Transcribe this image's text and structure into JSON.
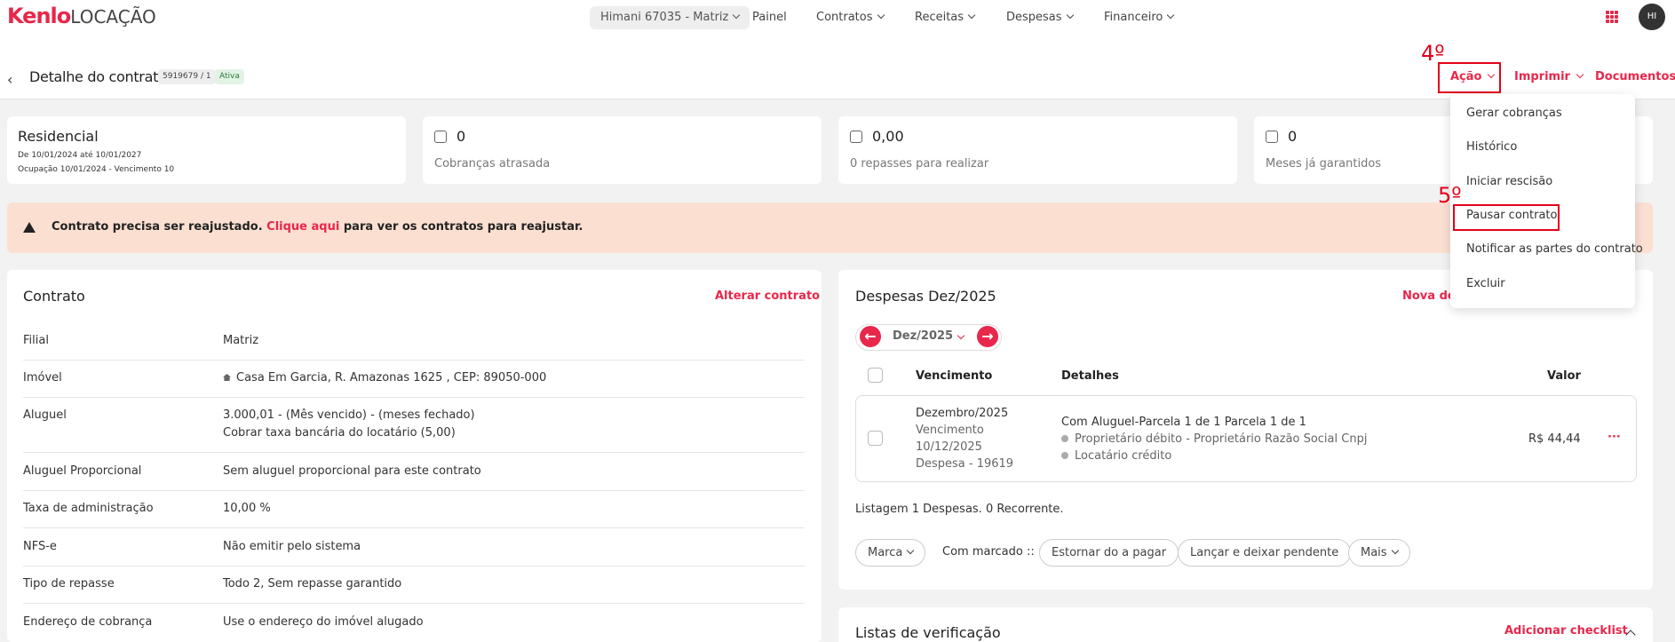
{
  "brand": {
    "kenlo": "Kenlo",
    "locacao": "LOCAÇÃO"
  },
  "nav": {
    "branch": "Himani 67035 - Matriz",
    "items": [
      "Painel",
      "Contratos",
      "Receitas",
      "Despesas",
      "Financeiro"
    ],
    "avatar": "HI"
  },
  "header": {
    "title": "Detalhe do contrato",
    "contract_number": "5919679 / 1",
    "status": "Ativa",
    "acao": "Ação",
    "imprimir": "Imprimir",
    "documentos": "Documentos"
  },
  "annotations": {
    "step4": "4º",
    "step5": "5º"
  },
  "summary": {
    "type": "Residencial",
    "period": "De 10/01/2024 até 10/01/2027",
    "occupancy": "Ocupação 10/01/2024 - Vencimento 10",
    "overdue_value": "0",
    "overdue_label": "Cobranças atrasada",
    "transfers_value": "0,00",
    "transfers_label": "0 repasses para realizar",
    "guaranteed_value": "0",
    "guaranteed_label": "Meses já garantidos"
  },
  "alert": {
    "before": "Contrato precisa ser reajustado.",
    "link": "Clique aqui",
    "after": "para ver os contratos para reajustar."
  },
  "contract": {
    "title": "Contrato",
    "edit_link": "Alterar contrato",
    "rows": [
      {
        "label": "Filial",
        "value": "Matriz"
      },
      {
        "label": "Imóvel",
        "value": "Casa Em Garcia, R. Amazonas 1625 , CEP: 89050-000"
      },
      {
        "label": "Aluguel",
        "value": "3.000,01 - (Mês vencido) - (meses fechado)",
        "value2": "Cobrar taxa bancária do locatário (5,00)"
      },
      {
        "label": "Aluguel Proporcional",
        "value": "Sem aluguel proporcional para este contrato"
      },
      {
        "label": "Taxa de administração",
        "value": "10,00 %"
      },
      {
        "label": "NFS-e",
        "value": "Não emitir pelo sistema"
      },
      {
        "label": "Tipo de repasse",
        "value": "Todo 2, Sem repasse garantido"
      },
      {
        "label": "Endereço de cobrança",
        "value": "Use o endereço do imóvel alugado"
      }
    ]
  },
  "expenses": {
    "title": "Despesas Dez/2025",
    "new_link": "Nova des",
    "month": "Dez/2025",
    "headers": {
      "due": "Vencimento",
      "details": "Detalhes",
      "value": "Valor"
    },
    "item": {
      "month": "Dezembro/2025",
      "due_label": "Vencimento",
      "due_date": "10/12/2025",
      "expense_id": "Despesa - 19619",
      "desc": "Com Aluguel-Parcela 1 de 1 Parcela 1 de 1",
      "debit": "Proprietário débito - Proprietário Razão Social Cnpj",
      "credit": "Locatário crédito",
      "value": "R$ 44,44",
      "more": "···"
    },
    "listing": "Listagem 1 Despesas. 0 Recorrente.",
    "marca": "Marca",
    "com_marcado": "Com marcado ::",
    "estornar": "Estornar do a pagar",
    "lancar": "Lançar e deixar pendente",
    "mais": "Mais"
  },
  "checklists": {
    "title": "Listas de verificação",
    "add_link": "Adicionar checklist"
  },
  "action_menu": [
    "Gerar cobranças",
    "Histórico",
    "Iniciar rescisão",
    "Pausar contrato",
    "Notificar as partes do contrato",
    "Excluir"
  ],
  "colors": {
    "accent": "#e8274b",
    "annotation": "#e3001b",
    "alert_bg": "#fbe0d2",
    "active_badge": "#e3f3e6"
  }
}
